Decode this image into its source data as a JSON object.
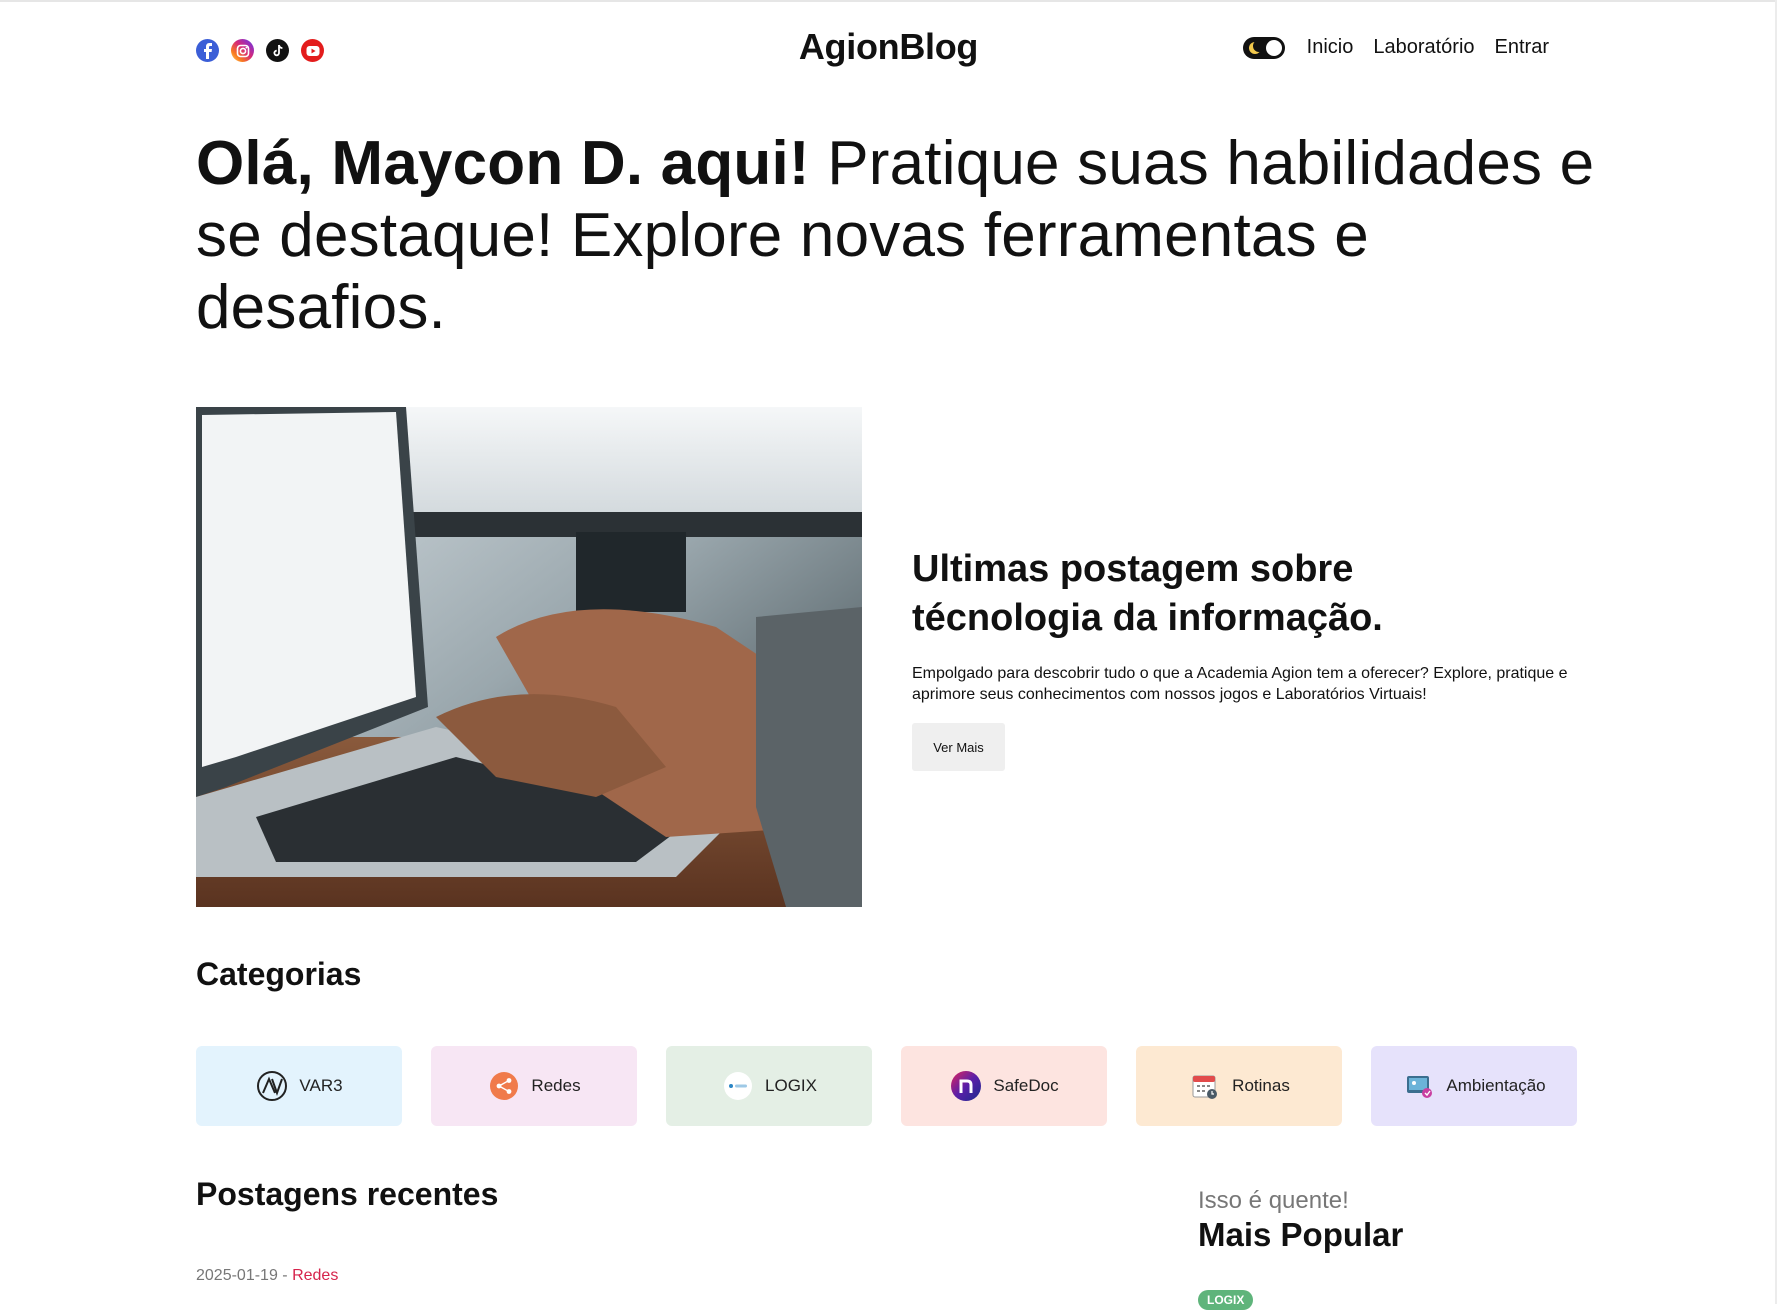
{
  "header": {
    "brand": "AgionBlog",
    "socials": [
      "facebook-icon",
      "instagram-icon",
      "tiktok-icon",
      "youtube-icon"
    ],
    "nav": {
      "home": "Inicio",
      "lab": "Laboratório",
      "login": "Entrar"
    }
  },
  "hero": {
    "greeting": "Olá, Maycon D. aqui!",
    "tagline": " Pratique suas habilidades e se destaque! Explore novas ferramentas e desafios."
  },
  "featured": {
    "title": "Ultimas postagem sobre técnologia da informação.",
    "description": "Empolgado para descobrir tudo o que a Academia Agion tem a oferecer? Explore, pratique e aprimore seus conhecimentos com nossos jogos e Laboratórios Virtuais!",
    "button": "Ver Mais"
  },
  "categories": {
    "title": "Categorias",
    "items": [
      {
        "label": "VAR3",
        "color": "#e3f3fd"
      },
      {
        "label": "Redes",
        "color": "#f7e6f4"
      },
      {
        "label": "LOGIX",
        "color": "#e4efe5"
      },
      {
        "label": "SafeDoc",
        "color": "#fde4e0"
      },
      {
        "label": "Rotinas",
        "color": "#fde9d2"
      },
      {
        "label": "Ambientação",
        "color": "#e6e2fb"
      }
    ]
  },
  "recent": {
    "title": "Postagens recentes",
    "first_post": {
      "date": "2025-01-19",
      "separator": " - ",
      "category": "Redes"
    }
  },
  "popular": {
    "kicker": "Isso é quente!",
    "title": "Mais Popular",
    "badge": "LOGIX"
  },
  "colors": {
    "accent": "#d6244c",
    "badge": "#5fb47b"
  }
}
